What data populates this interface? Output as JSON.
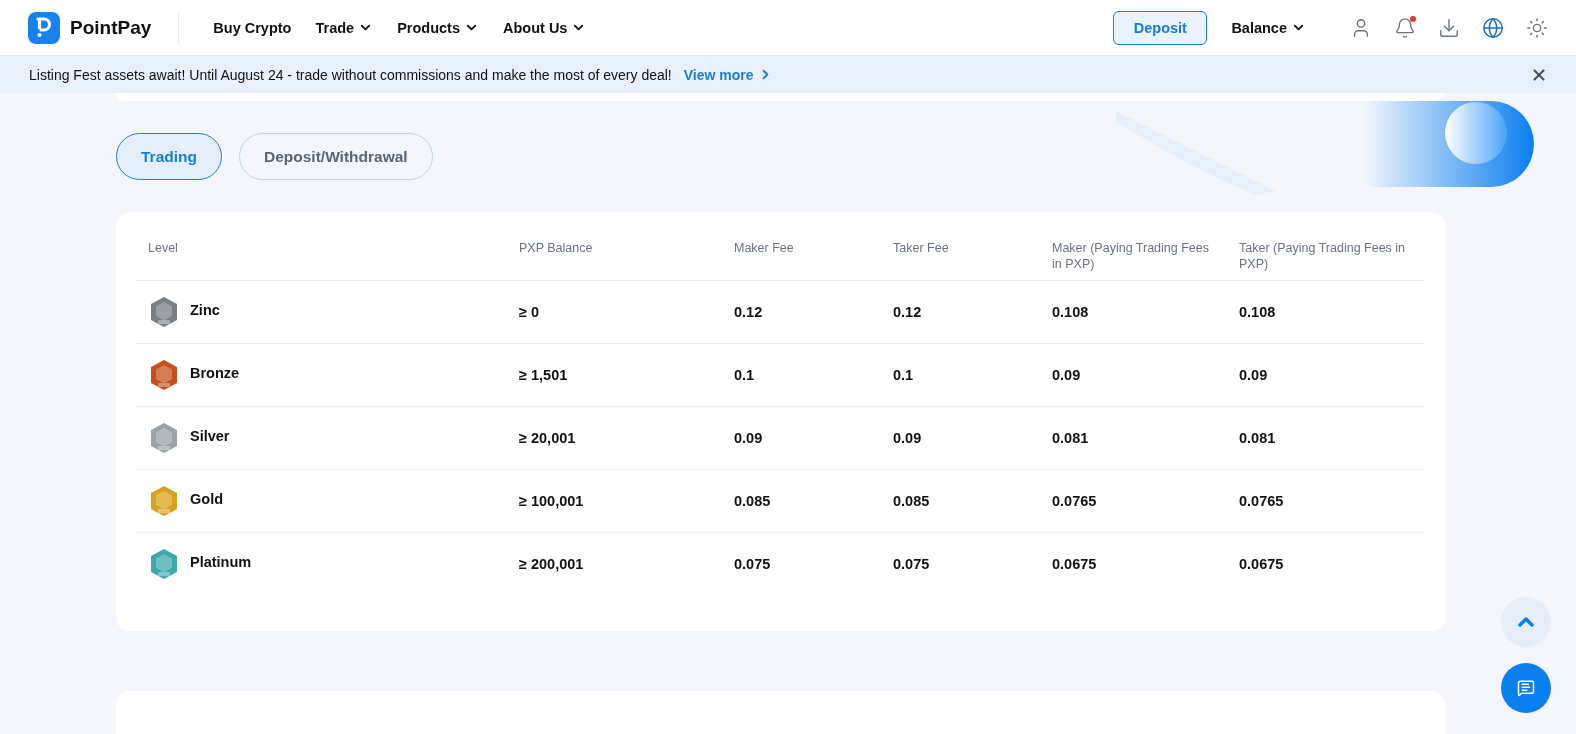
{
  "header": {
    "brand": "PointPay",
    "nav": [
      {
        "label": "Buy Crypto",
        "dropdown": false
      },
      {
        "label": "Trade",
        "dropdown": true
      },
      {
        "label": "Products",
        "dropdown": true
      },
      {
        "label": "About Us",
        "dropdown": true
      }
    ],
    "deposit_button": "Deposit",
    "balance": "Balance",
    "notification_unread": true
  },
  "banner": {
    "text": "Listing Fest assets await! Until August 24 - trade without commissions and make the most of every deal!",
    "link": "View more"
  },
  "tabs": [
    {
      "label": "Trading",
      "selected": true
    },
    {
      "label": "Deposit/Withdrawal",
      "selected": false
    }
  ],
  "table": {
    "columns": [
      "Level",
      "PXP Balance",
      "Maker Fee",
      "Taker Fee",
      "Maker (Paying Trading Fees in PXP)",
      "Taker (Paying Trading Fees in PXP)"
    ],
    "rows": [
      {
        "level": "Zinc",
        "color": "#7a7f85",
        "balance": "≥ 0",
        "maker": "0.12",
        "taker": "0.12",
        "maker_pxp": "0.108",
        "taker_pxp": "0.108"
      },
      {
        "level": "Bronze",
        "color": "#c4501c",
        "balance": "≥ 1,501",
        "maker": "0.1",
        "taker": "0.1",
        "maker_pxp": "0.09",
        "taker_pxp": "0.09"
      },
      {
        "level": "Silver",
        "color": "#98a3a8",
        "balance": "≥ 20,001",
        "maker": "0.09",
        "taker": "0.09",
        "maker_pxp": "0.081",
        "taker_pxp": "0.081"
      },
      {
        "level": "Gold",
        "color": "#d9a21c",
        "balance": "≥ 100,001",
        "maker": "0.085",
        "taker": "0.085",
        "maker_pxp": "0.0765",
        "taker_pxp": "0.0765"
      },
      {
        "level": "Platinum",
        "color": "#3fa8ad",
        "balance": "≥ 200,001",
        "maker": "0.075",
        "taker": "0.075",
        "maker_pxp": "0.0675",
        "taker_pxp": "0.0675"
      }
    ]
  }
}
